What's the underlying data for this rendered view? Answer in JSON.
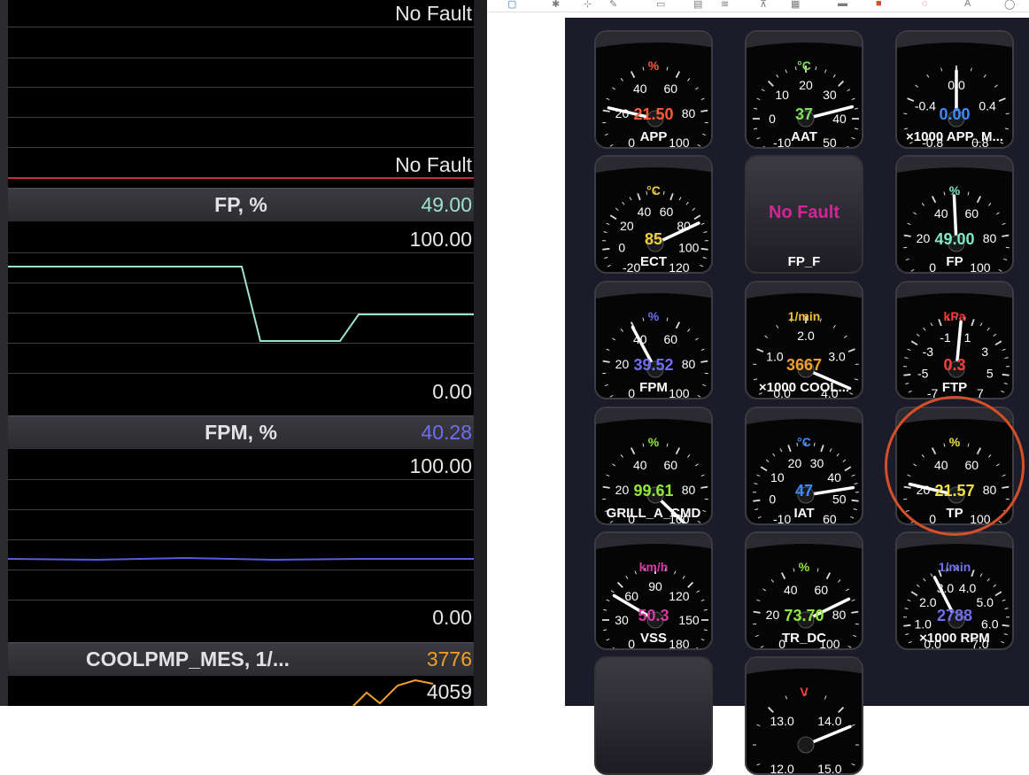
{
  "left_panel": {
    "top_fault_1": "No Fault",
    "top_fault_2": "No Fault",
    "fp": {
      "title": "FP, %",
      "value": "49.00",
      "max": "100.00",
      "min": "0.00",
      "color": "#9ee3c8"
    },
    "fpm": {
      "title": "FPM, %",
      "value": "40.28",
      "max": "100.00",
      "min": "0.00",
      "color": "#6f6ff0"
    },
    "coolpmp": {
      "title": "COOLPMP_MES, 1/...",
      "value": "3776",
      "max": "4059",
      "color": "#f0a028"
    }
  },
  "gauges": [
    {
      "label": "APP",
      "value": "21.50",
      "unit": "%",
      "value_color": "#ff5a3c",
      "unit_color": "#ff5a3c",
      "ticks": [
        "0",
        "20",
        "40",
        "60",
        "80",
        "100"
      ],
      "needle_fraction": 0.215
    },
    {
      "label": "AAT",
      "value": "37",
      "unit": "°C",
      "value_color": "#7ee05a",
      "unit_color": "#7ee05a",
      "ticks": [
        "-10",
        "0",
        "10",
        "20",
        "30",
        "40",
        "50"
      ],
      "needle_fraction": 0.78
    },
    {
      "label": "×1000 APP_M...",
      "value": "0.00",
      "unit": "",
      "value_color": "#3c8cff",
      "unit_color": "#3c8cff",
      "ticks": [
        "-0.8",
        "-0.4",
        "0.0",
        "0.4",
        "0.8"
      ],
      "needle_fraction": 0.5
    },
    {
      "label": "ECT",
      "value": "85",
      "unit": "°C",
      "value_color": "#f0d040",
      "unit_color": "#f0d040",
      "ticks": [
        "-20",
        "0",
        "20",
        "40",
        "60",
        "80",
        "100",
        "120"
      ],
      "needle_fraction": 0.74
    },
    {
      "label": "FP_F",
      "value": "No Fault",
      "nofault": true
    },
    {
      "label": "FP",
      "value": "49.00",
      "unit": "%",
      "value_color": "#7fe8c8",
      "unit_color": "#7fe8c8",
      "ticks": [
        "0",
        "20",
        "40",
        "60",
        "80",
        "100"
      ],
      "needle_fraction": 0.49
    },
    {
      "label": "FPM",
      "value": "39.52",
      "unit": "%",
      "value_color": "#6f6ff0",
      "unit_color": "#6f6ff0",
      "ticks": [
        "0",
        "20",
        "40",
        "60",
        "80",
        "100"
      ],
      "needle_fraction": 0.3952
    },
    {
      "label": "×1000 COOL...",
      "value": "3667",
      "unit": "1/min",
      "value_color": "#f0a028",
      "unit_color": "#f0c030",
      "ticks": [
        "0.0",
        "1.0",
        "2.0",
        "3.0",
        "4.0"
      ],
      "needle_fraction": 0.92
    },
    {
      "label": "FTP",
      "value": "0.3",
      "unit": "kPa",
      "value_color": "#ff3c3c",
      "unit_color": "#ff3c3c",
      "ticks": [
        "-7",
        "-5",
        "-3",
        "-1",
        "1",
        "3",
        "5",
        "7"
      ],
      "needle_fraction": 0.52
    },
    {
      "label": "GRILL_A_CMD",
      "value": "99.61",
      "unit": "%",
      "value_color": "#8fe83a",
      "unit_color": "#8fe83a",
      "ticks": [
        "0",
        "20",
        "40",
        "60",
        "80",
        "100"
      ],
      "needle_fraction": 0.9961
    },
    {
      "label": "IAT",
      "value": "47",
      "unit": "°C",
      "value_color": "#3c8cff",
      "unit_color": "#3c8cff",
      "ticks": [
        "-10",
        "0",
        "10",
        "20",
        "30",
        "40",
        "50",
        "60"
      ],
      "needle_fraction": 0.8
    },
    {
      "label": "TP",
      "value": "21.57",
      "unit": "%",
      "value_color": "#f0e040",
      "unit_color": "#f0e040",
      "ticks": [
        "0",
        "20",
        "40",
        "60",
        "80",
        "100"
      ],
      "needle_fraction": 0.2157
    },
    {
      "label": "VSS",
      "value": "50.3",
      "unit": "km/h",
      "value_color": "#d23ca0",
      "unit_color": "#d23ca0",
      "ticks": [
        "0",
        "30",
        "60",
        "90",
        "120",
        "150",
        "180"
      ],
      "needle_fraction": 0.28
    },
    {
      "label": "TR_DC",
      "value": "73.70",
      "unit": "%",
      "value_color": "#8fe83a",
      "unit_color": "#8fe83a",
      "ticks": [
        "0",
        "20",
        "40",
        "60",
        "80",
        "100"
      ],
      "needle_fraction": 0.737
    },
    {
      "label": "×1000 RPM",
      "value": "2788",
      "unit": "1/min",
      "value_color": "#6f6ff0",
      "unit_color": "#6f6ff0",
      "ticks": [
        "0.0",
        "1.0",
        "2.0",
        "3.0",
        "4.0",
        "5.0",
        "6.0",
        "7.0"
      ],
      "needle_fraction": 0.4
    },
    {
      "label": "",
      "value": "",
      "empty": true
    },
    {
      "label": "",
      "value": "",
      "unit": "V",
      "value_color": "#ff3c3c",
      "unit_color": "#ff3c3c",
      "ticks": [
        "12.0",
        "13.0",
        "14.0",
        "15.0"
      ],
      "needle_fraction": 0.75,
      "partial": true
    }
  ]
}
